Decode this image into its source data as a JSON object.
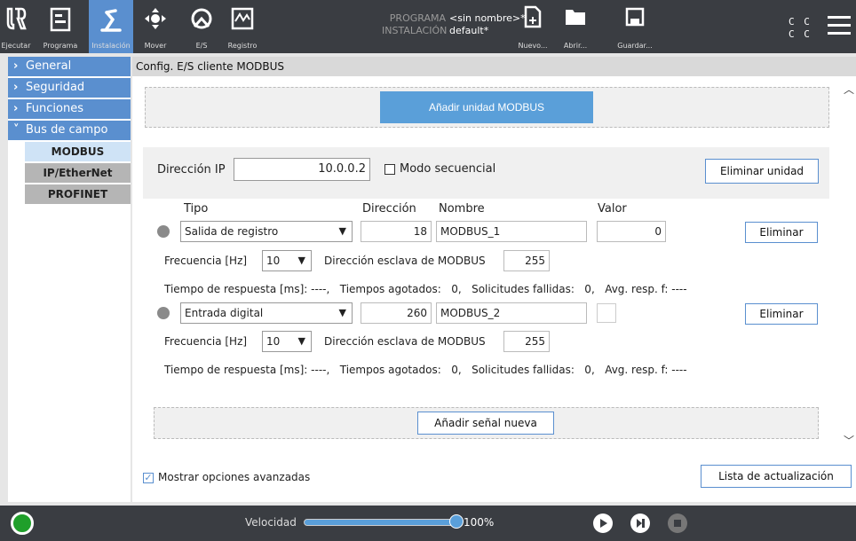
{
  "topbar": {
    "tabs": [
      {
        "label": "Ejecutar"
      },
      {
        "label": "Programa"
      },
      {
        "label": "Instalación"
      },
      {
        "label": "Mover"
      },
      {
        "label": "E/S"
      },
      {
        "label": "Registro"
      }
    ],
    "program_key": "PROGRAMA",
    "program_value": "<sin nombre>*",
    "installation_key": "INSTALACIÓN",
    "installation_value": "default*",
    "actions": [
      {
        "label": "Nuevo..."
      },
      {
        "label": "Abrir..."
      },
      {
        "label": "Guardar..."
      }
    ],
    "cc_line1": "C C",
    "cc_line2": "C C"
  },
  "sidebar": {
    "sections": [
      {
        "label": "General",
        "expanded": false
      },
      {
        "label": "Seguridad",
        "expanded": false
      },
      {
        "label": "Funciones",
        "expanded": false
      },
      {
        "label": "Bus de campo",
        "expanded": true
      }
    ],
    "subitems": [
      {
        "label": "MODBUS",
        "active": true
      },
      {
        "label": "IP/EtherNet",
        "active": false
      },
      {
        "label": "PROFINET",
        "active": false
      }
    ]
  },
  "main": {
    "title": "Config. E/S cliente MODBUS",
    "add_unit_label": "Añadir unidad MODBUS",
    "unit": {
      "ip_label": "Dirección IP",
      "ip_value": "10.0.0.2",
      "seq_label": "Modo secuencial",
      "delete_unit_label": "Eliminar unidad",
      "headers": {
        "type": "Tipo",
        "address": "Dirección",
        "name": "Nombre",
        "value": "Valor"
      },
      "signals": [
        {
          "type": "Salida de registro",
          "address": "18",
          "name": "MODBUS_1",
          "value": "0",
          "delete_label": "Eliminar",
          "freq_label": "Frecuencia [Hz]",
          "freq_value": "10",
          "slave_label": "Dirección esclava de MODBUS",
          "slave_value": "255",
          "stats": "Tiempo de respuesta [ms]: ----,   Tiempos agotados:   0,   Solicitudes fallidas:   0,   Avg. resp. f: ----"
        },
        {
          "type": "Entrada digital",
          "address": "260",
          "name": "MODBUS_2",
          "value": "",
          "delete_label": "Eliminar",
          "freq_label": "Frecuencia [Hz]",
          "freq_value": "10",
          "slave_label": "Dirección esclava de MODBUS",
          "slave_value": "255",
          "stats": "Tiempo de respuesta [ms]: ----,   Tiempos agotados:   0,   Solicitudes fallidas:   0,   Avg. resp. f: ----"
        }
      ],
      "add_signal_label": "Añadir señal nueva"
    },
    "advanced_label": "Mostrar opciones avanzadas",
    "advanced_checked": true,
    "refresh_label": "Lista de actualización"
  },
  "bottombar": {
    "speed_label": "Velocidad",
    "speed_value": "100%",
    "speed_fraction": 1.0
  },
  "colors": {
    "accent": "#5a8fcf",
    "bar_bg": "#3a3d42",
    "status_green": "#1f9f2a"
  }
}
